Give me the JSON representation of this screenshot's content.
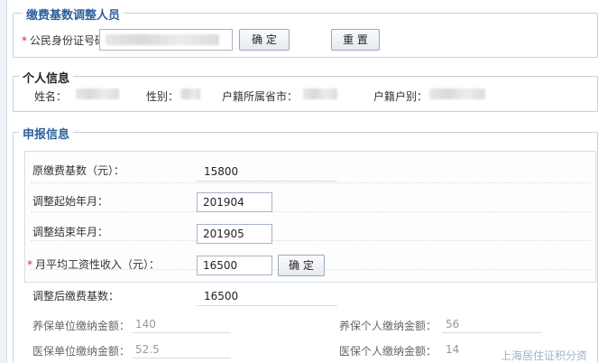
{
  "adjust": {
    "legend": "缴费基数调整人员",
    "id_label": "公民身份证号码：",
    "confirm_label": "确 定",
    "reset_label": "重 置"
  },
  "personal": {
    "legend": "个人信息",
    "name_label": "姓名：",
    "gender_label": "性别：",
    "province_label": "户籍所属省市：",
    "household_label": "户籍户别："
  },
  "report": {
    "legend": "申报信息",
    "orig_base_label": "原缴费基数（元）：",
    "orig_base_value": "15800",
    "start_label": "调整起始年月：",
    "start_value": "201904",
    "end_label": "调整结束年月：",
    "end_value": "201905",
    "income_label": "月平均工资性收入（元）：",
    "income_value": "16500",
    "income_confirm_label": "确 定",
    "new_base_label": "调整后缴费基数：",
    "new_base_value": "16500",
    "pension_unit_label": "养保单位缴纳金额：",
    "pension_unit_value": "140",
    "pension_person_label": "养保个人缴纳金额：",
    "pension_person_value": "56",
    "medical_unit_label": "医保单位缴纳金额：",
    "medical_unit_value": "52.5",
    "medical_person_label": "医保个人缴纳金额：",
    "medical_person_value": "14"
  },
  "watermark": "上海居住证积分资"
}
